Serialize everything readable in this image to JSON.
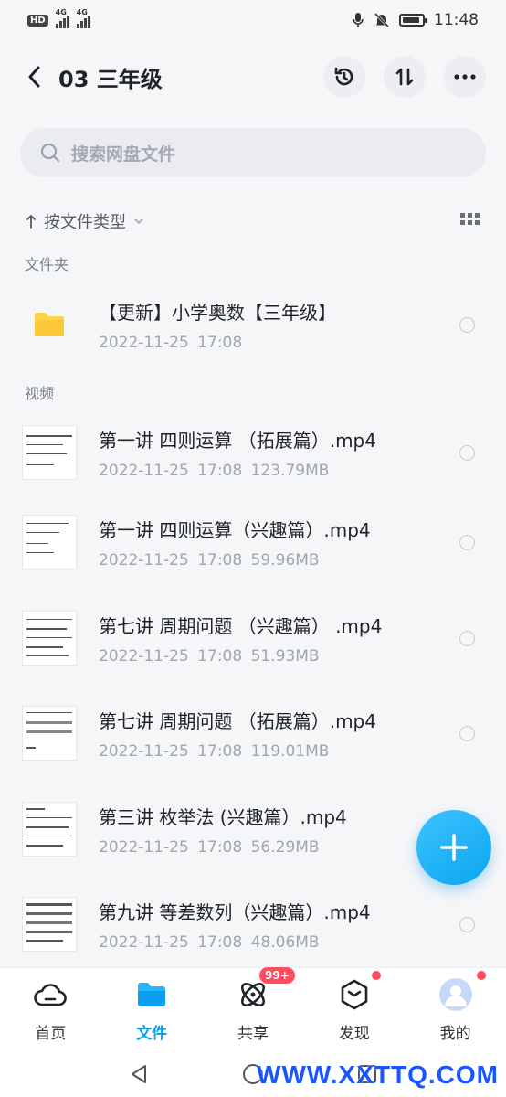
{
  "status_bar": {
    "time": "11:48",
    "network1": "4G",
    "network2": "4G",
    "hd": "HD"
  },
  "header": {
    "title": "03 三年级"
  },
  "search": {
    "placeholder": "搜索网盘文件"
  },
  "sort": {
    "label": "按文件类型"
  },
  "sections": {
    "folders": "文件夹",
    "videos": "视频"
  },
  "folder": {
    "name": "【更新】小学奥数【三年级】",
    "meta": "2022-11-25 17:08"
  },
  "videos": [
    {
      "name": "第一讲 四则运算 （拓展篇）.mp4",
      "meta": "2022-11-25 17:08 123.79MB"
    },
    {
      "name": "第一讲 四则运算（兴趣篇）.mp4",
      "meta": "2022-11-25 17:08 59.96MB"
    },
    {
      "name": "第七讲 周期问题 （兴趣篇） .mp4",
      "meta": "2022-11-25 17:08 51.93MB"
    },
    {
      "name": "第七讲 周期问题 （拓展篇）.mp4",
      "meta": "2022-11-25 17:08 119.01MB"
    },
    {
      "name": "第三讲 枚举法 (兴趣篇）.mp4",
      "meta": "2022-11-25 17:08 56.29MB"
    },
    {
      "name": "第九讲 等差数列（兴趣篇）.mp4",
      "meta": "2022-11-25 17:08 48.06MB"
    }
  ],
  "nav": {
    "home": "首页",
    "files": "文件",
    "share": "共享",
    "share_badge": "99+",
    "discover": "发现",
    "me": "我的"
  },
  "watermark": "WWW.XXTTQ.COM",
  "colors": {
    "accent": "#0aa0f0",
    "badge": "#ff4d5e",
    "folder": "#fcd34d"
  }
}
